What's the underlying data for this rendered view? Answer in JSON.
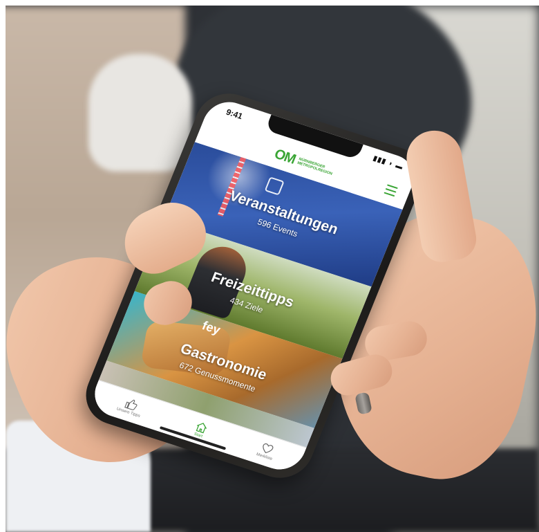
{
  "status_bar": {
    "time": "9:41",
    "icons": "▮▮▮ ◗ ▬"
  },
  "app": {
    "logo_mark": "OM",
    "logo_text_line1": "NÜRNBERGER",
    "logo_text_line2": "METROPOLREGION",
    "brand_color": "#3aa535"
  },
  "tiles": [
    {
      "title": "Veranstaltungen",
      "subtitle": "596 Events"
    },
    {
      "title": "Freizeittipps",
      "subtitle": "434 Ziele"
    },
    {
      "title": "Gastronomie",
      "subtitle": "672 Genussmomente"
    }
  ],
  "food_tile_logo": "fey",
  "tabbar": {
    "items": [
      {
        "label": "Unsere Tipps",
        "icon": "thumbs-up-icon"
      },
      {
        "label": "Start",
        "icon": "home-icon",
        "active": true
      },
      {
        "label": "Merkliste",
        "icon": "heart-icon"
      }
    ]
  }
}
